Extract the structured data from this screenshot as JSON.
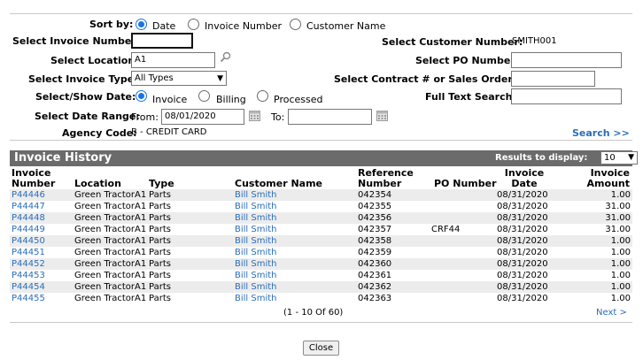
{
  "sort": {
    "label": "Sort by:",
    "options": [
      "Date",
      "Invoice Number",
      "Customer Name"
    ],
    "selected": "Date"
  },
  "filters": {
    "invoice_number_label": "Select Invoice Number:",
    "invoice_number_value": "",
    "location_label": "Select Location:",
    "location_value": "A1",
    "invoice_type_label": "Select Invoice Type:",
    "invoice_type_value": "All Types",
    "show_date_label": "Select/Show Date:",
    "show_date_options": [
      "Invoice",
      "Billing",
      "Processed"
    ],
    "show_date_selected": "Invoice",
    "date_range_label": "Select Date Range:",
    "from_label": "From:",
    "from_value": "08/01/2020",
    "to_label": "To:",
    "to_value": "",
    "agency_label": "Agency Code:",
    "agency_value": "B -  CREDIT CARD",
    "customer_number_label": "Select Customer Number:",
    "customer_number_value": "SMITH001",
    "po_number_label": "Select PO Number:",
    "po_number_value": "",
    "contract_label": "Select Contract # or Sales Order #:",
    "contract_value": "",
    "full_text_label": "Full Text Search:",
    "full_text_value": "",
    "search_link": "Search >>"
  },
  "history": {
    "title": "Invoice History",
    "results_label": "Results to display:",
    "results_value": "10",
    "headers": {
      "invoice_number": [
        "Invoice",
        "Number"
      ],
      "location": "Location",
      "type": "Type",
      "customer_name": "Customer Name",
      "reference_number": [
        "Reference",
        "Number"
      ],
      "po_number": "PO Number",
      "invoice_date": [
        "Invoice",
        "Date"
      ],
      "invoice_amount": [
        "Invoice",
        "Amount"
      ]
    },
    "rows": [
      {
        "invoice": "P44446",
        "location": "Green TractorA1",
        "type": "Parts",
        "customer": "Bill Smith",
        "reference": "042354",
        "po": "",
        "date": "08/31/2020",
        "amount": "1.00"
      },
      {
        "invoice": "P44447",
        "location": "Green TractorA1",
        "type": "Parts",
        "customer": "Bill Smith",
        "reference": "042355",
        "po": "",
        "date": "08/31/2020",
        "amount": "31.00"
      },
      {
        "invoice": "P44448",
        "location": "Green TractorA1",
        "type": "Parts",
        "customer": "Bill Smith",
        "reference": "042356",
        "po": "",
        "date": "08/31/2020",
        "amount": "31.00"
      },
      {
        "invoice": "P44449",
        "location": "Green TractorA1",
        "type": "Parts",
        "customer": "Bill Smith",
        "reference": "042357",
        "po": "CRF44",
        "date": "08/31/2020",
        "amount": "31.00"
      },
      {
        "invoice": "P44450",
        "location": "Green TractorA1",
        "type": "Parts",
        "customer": "Bill Smith",
        "reference": "042358",
        "po": "",
        "date": "08/31/2020",
        "amount": "1.00"
      },
      {
        "invoice": "P44451",
        "location": "Green TractorA1",
        "type": "Parts",
        "customer": "Bill Smith",
        "reference": "042359",
        "po": "",
        "date": "08/31/2020",
        "amount": "1.00"
      },
      {
        "invoice": "P44452",
        "location": "Green TractorA1",
        "type": "Parts",
        "customer": "Bill Smith",
        "reference": "042360",
        "po": "",
        "date": "08/31/2020",
        "amount": "1.00"
      },
      {
        "invoice": "P44453",
        "location": "Green TractorA1",
        "type": "Parts",
        "customer": "Bill Smith",
        "reference": "042361",
        "po": "",
        "date": "08/31/2020",
        "amount": "1.00"
      },
      {
        "invoice": "P44454",
        "location": "Green TractorA1",
        "type": "Parts",
        "customer": "Bill Smith",
        "reference": "042362",
        "po": "",
        "date": "08/31/2020",
        "amount": "1.00"
      },
      {
        "invoice": "P44455",
        "location": "Green TractorA1",
        "type": "Parts",
        "customer": "Bill Smith",
        "reference": "042363",
        "po": "",
        "date": "08/31/2020",
        "amount": "1.00"
      }
    ],
    "pagination_text": "(1 - 10 Of 60)",
    "next_link": "Next >"
  },
  "close_label": "Close",
  "colors": {
    "link": "#2a6ebb",
    "header_bar": "#6b6b6b",
    "row_alt": "#ececec",
    "radio_accent": "#1a73e8"
  },
  "icons": {
    "location_lookup": "magnifier-icon",
    "date_picker": "calendar-icon"
  }
}
